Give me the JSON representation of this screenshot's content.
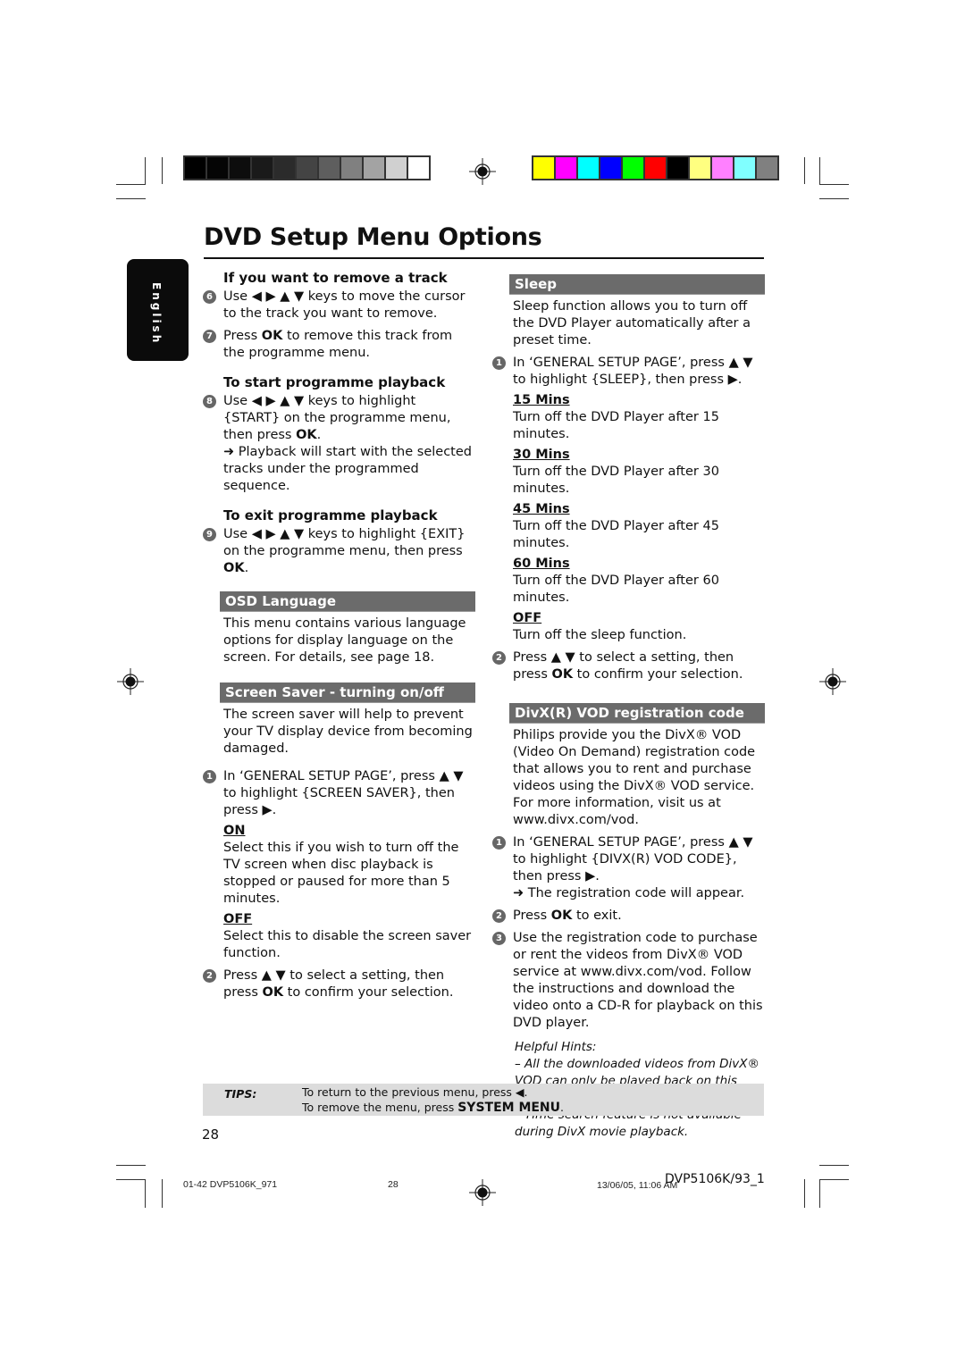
{
  "print_marks": {
    "grayscale_swatches": [
      "#000000",
      "#050505",
      "#0d0d0d",
      "#1a1a1a",
      "#2b2b2b",
      "#444444",
      "#5e5e5e",
      "#808080",
      "#a3a3a3",
      "#d0d0d0",
      "#ffffff"
    ],
    "color_swatches": [
      "#ffff00",
      "#ff00ff",
      "#00ffff",
      "#0000ff",
      "#00ff00",
      "#ff0000",
      "#000000",
      "#ffff80",
      "#ff80ff",
      "#80ffff",
      "#808080"
    ]
  },
  "page": {
    "title": "DVD Setup Menu Options",
    "language_tab": "English",
    "page_number": "28"
  },
  "left_column": {
    "remove_track": {
      "heading": "If you want to remove a track",
      "step6_num": "6",
      "step6_text": "Use ◀ ▶ ▲ ▼ keys to move the cursor to the track you want to remove.",
      "step7_num": "7",
      "step7_pre": "Press ",
      "step7_bold": "OK",
      "step7_post": " to remove this track from the programme menu."
    },
    "start_playback": {
      "heading": "To start programme playback",
      "step8_num": "8",
      "step8_pre": "Use ◀ ▶ ▲ ▼ keys to highlight {START} on the programme menu, then press ",
      "step8_bold": "OK",
      "step8_post": ".",
      "step8_result": "➜ Playback will start with the selected tracks under the programmed sequence."
    },
    "exit_playback": {
      "heading": "To exit programme playback",
      "step9_num": "9",
      "step9_pre": "Use ◀ ▶ ▲ ▼ keys to highlight {EXIT} on the programme menu, then press ",
      "step9_bold": "OK",
      "step9_post": "."
    },
    "osd_language": {
      "heading": "OSD Language",
      "text": "This menu contains various language options for display language on the screen. For details, see page 18."
    },
    "screen_saver": {
      "heading": "Screen Saver - turning on/off",
      "intro": "The screen saver will help to prevent your TV display device from becoming damaged.",
      "step1_num": "1",
      "step1_text": "In ‘GENERAL SETUP PAGE’, press ▲ ▼ to highlight {SCREEN SAVER}, then press ▶.",
      "options": [
        {
          "label": "ON",
          "desc": "Select this if you wish to turn off the TV screen when disc playback is stopped or paused for more than 5 minutes."
        },
        {
          "label": "OFF",
          "desc": "Select this to disable the screen saver function."
        }
      ],
      "step2_num": "2",
      "step2_pre": "Press ▲ ▼  to select a setting, then press ",
      "step2_bold": "OK",
      "step2_post": " to confirm your selection."
    }
  },
  "right_column": {
    "sleep": {
      "heading": "Sleep",
      "intro": "Sleep function allows you to turn off the DVD Player automatically after a preset time.",
      "step1_num": "1",
      "step1_text": "In ‘GENERAL SETUP PAGE’, press ▲ ▼ to highlight {SLEEP}, then press ▶.",
      "options": [
        {
          "label": "15 Mins",
          "desc": "Turn off the DVD Player after 15 minutes."
        },
        {
          "label": "30 Mins",
          "desc": "Turn off the DVD Player after 30 minutes."
        },
        {
          "label": "45 Mins",
          "desc": "Turn off the DVD Player after 45 minutes."
        },
        {
          "label": "60 Mins",
          "desc": "Turn off the DVD Player after 60 minutes."
        },
        {
          "label": "OFF",
          "desc": "Turn off the sleep function."
        }
      ],
      "step2_num": "2",
      "step2_pre": "Press ▲ ▼ to select a setting, then press ",
      "step2_bold": "OK",
      "step2_post": " to confirm your selection."
    },
    "divx": {
      "heading": "DivX(R) VOD registration code",
      "intro": "Philips provide you the DivX® VOD (Video On Demand) registration code that allows you to rent and purchase videos using the DivX® VOD service. For more information, visit us at www.divx.com/vod.",
      "step1_num": "1",
      "step1_text": "In ‘GENERAL SETUP PAGE’, press ▲ ▼ to highlight {DIVX(R) VOD CODE}, then press ▶.",
      "step1_result": "➜ The registration code will appear.",
      "step2_num": "2",
      "step2_pre": "Press ",
      "step2_bold": "OK",
      "step2_post": " to exit.",
      "step3_num": "3",
      "step3_text": "Use the registration code to purchase or rent the videos from DivX® VOD service at www.divx.com/vod. Follow the instructions and download the video onto a CD-R for playback on this DVD player.",
      "hints_title": "Helpful Hints:",
      "hints": [
        "–    All the downloaded videos from DivX® VOD can only be played back on this DVD player.",
        "–    Time search feature is not available during DivX movie playback."
      ]
    }
  },
  "tips": {
    "label": "TIPS:",
    "line1": "To return to the previous menu, press ◀.",
    "line2_pre": "To remove the menu, press ",
    "line2_bold": "SYSTEM MENU",
    "line2_post": "."
  },
  "footer": {
    "file": "01-42 DVP5106K_971",
    "page": "28",
    "datetime": "13/06/05, 11:06 AM",
    "model": "DVP5106K/93_1"
  }
}
